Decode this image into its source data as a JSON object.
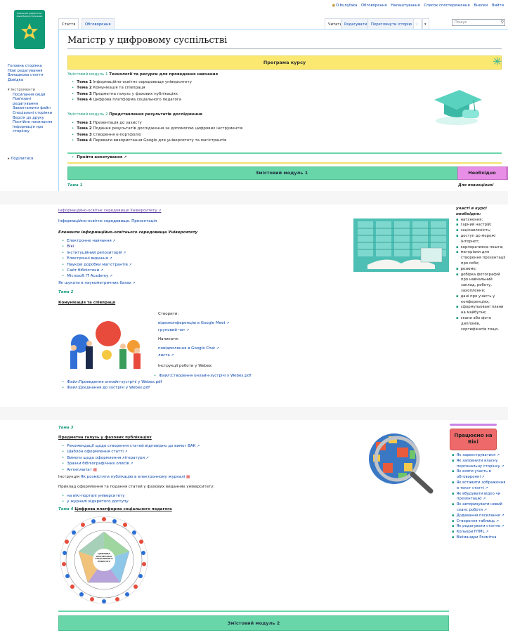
{
  "personal": [
    "O.bunyfaka",
    "Обговорення",
    "Налаштування",
    "Список спостереження",
    "Внески",
    "Вийти"
  ],
  "logo_text": "Київський університет імені Бориса Грінченка",
  "sidebar": {
    "nav": [
      "Головна сторінка",
      "Нові редагування",
      "Випадкова стаття",
      "Довідка"
    ],
    "tools_header": "Інструменти",
    "tools": [
      "Посилання сюди",
      "Пов'язані редагування",
      "Завантажити файл",
      "Спеціальні сторінки",
      "Версія до друку",
      "Постійне посилання",
      "Інформація про сторінку"
    ],
    "share": "Поділитися"
  },
  "tabs": {
    "article": "Стаття",
    "discussion": "Обговорення",
    "read": "Читати",
    "edit": "Редагувати",
    "history": "Переглянути історію"
  },
  "search": {
    "placeholder": "Пошук"
  },
  "page": {
    "title": "Магістр у цифровому суспільстві",
    "banner": "Програма курсу",
    "module1": {
      "label": "Змістовий модуль 1",
      "title": "Технології та ресурси для проведення навчання"
    },
    "m1_topics": [
      {
        "t": "Тема 1",
        "d": "Інформаційно-освітнє середовище університету"
      },
      {
        "t": "Тема 2",
        "d": "Комунікація та співпраця"
      },
      {
        "t": "Тема 3",
        "d": "Предметна галузь у фахових публікаціях"
      },
      {
        "t": "Тема 4",
        "d": "Цифрова платформа соціального педагога"
      }
    ],
    "module2": {
      "label": "Змістовий модуль 2",
      "title": "Представлення результатів дослідження"
    },
    "m2_topics": [
      {
        "t": "Тема 1",
        "d": "Презентація до захисту"
      },
      {
        "t": "Тема 2",
        "d": "Подання результатів дослідження за допомогою цифрових інструментів"
      },
      {
        "t": "Тема 3",
        "d": "Створення е-портфоліо"
      },
      {
        "t": "Тема 4",
        "d": "Переваги використання Google для університету та магістрантів"
      }
    ],
    "survey": "Пройти анкетування",
    "module1_bar": "Змістовий модуль 1",
    "necessary": "Необхідно",
    "topic1": "Тема 1",
    "full": "Для повноцінної"
  },
  "mid": {
    "link1": "Інформаційно-освітнє середовище Університету",
    "link2": "Інформаційно-освітнє середовище. Презентація",
    "elements": "Елементи інформаційно-освітнього середовища Університету",
    "items": [
      "Електронне навчання",
      "Вікі",
      "Інституційний репозиторій",
      "Електронні видання",
      "Наукові доробки магістрантів",
      "Сайт бібліотеки",
      "Microsoft IT Academy"
    ],
    "search_db": "Як шукати в наукометричних базах",
    "topic2": "Тема 2",
    "comm": "Комунікація та співпраця",
    "create": "Створити:",
    "videoconf": "відеоконференцію в Google Meet",
    "groupchat": "груповий чат",
    "write": "Написати:",
    "chatmsg": "повідомлення в Google Chat",
    "letter": "листа",
    "webex_instr": "Інструкції роботи у Webex:",
    "webex_file": "Файл:Створення онлайн-зустрічі у Webex.pdf",
    "files": [
      "Файл:Проведення онлайн-зустрічі у Webex.pdf",
      "Файл:Доєднання до зустрічі у Webex.pdf"
    ],
    "right_head": "участі в курсі необхідно:",
    "right_items": [
      "натхнення;",
      "гарний настрій;",
      "зацікавленість;",
      "доступ до мережі Інтернет;",
      "корпоративна пошта;",
      "матеріали для створення презентації про себе;",
      "резюме;",
      "добірка фотографій про навчальний заклад, роботу, захоплення;",
      "дані про участь у конференціях;",
      "сформульовані плани на майбутнє;",
      "скани або фото дипломів, сертифікатів тощо."
    ]
  },
  "bot": {
    "topic3": "Тема 3",
    "pubs": "Предметна галузь у фахових публікаціях",
    "items": [
      "Рекомендації щодо створення статей відповідно до вимог ВАК",
      "Шаблон оформлення статті",
      "Вимоги щодо оформлення літератури",
      "Зразки бібліографічних описів",
      "Антиплагіат"
    ],
    "instr_pre": "Інструкція",
    "instr_link": "Як розмістити публікацію в електронному журналі",
    "example": "Приклад оформлення та подання статей у фахових виданнях університету:",
    "ex_items": [
      "на вікі-порталі університету",
      "у журналі відкритого доступу"
    ],
    "topic4": "Тема 4",
    "platform": "Цифрова платформа соціального педагога",
    "wheel": "ЦИФРОВА ПЛАТФОРМА СОЦІАЛЬНОГО ПЕДАГОГА",
    "module2_bar": "Змістовий модуль 2",
    "wiki_work": "Працюємо на Вікі",
    "wiki_items": [
      "Як зареєструватися",
      "Як заповнити власну персональну сторінку",
      "Як взяти участь в обговоренні",
      "Як вставити зображення в текст статті",
      "Як вбудувати відео чи презентацію",
      "Як авторизувати новий сеанс роботи",
      "Додавання посилання",
      "Створення таблиць",
      "Як редагувати статтю",
      "Кольори HTML",
      "Вікімандри Розмітка"
    ]
  }
}
